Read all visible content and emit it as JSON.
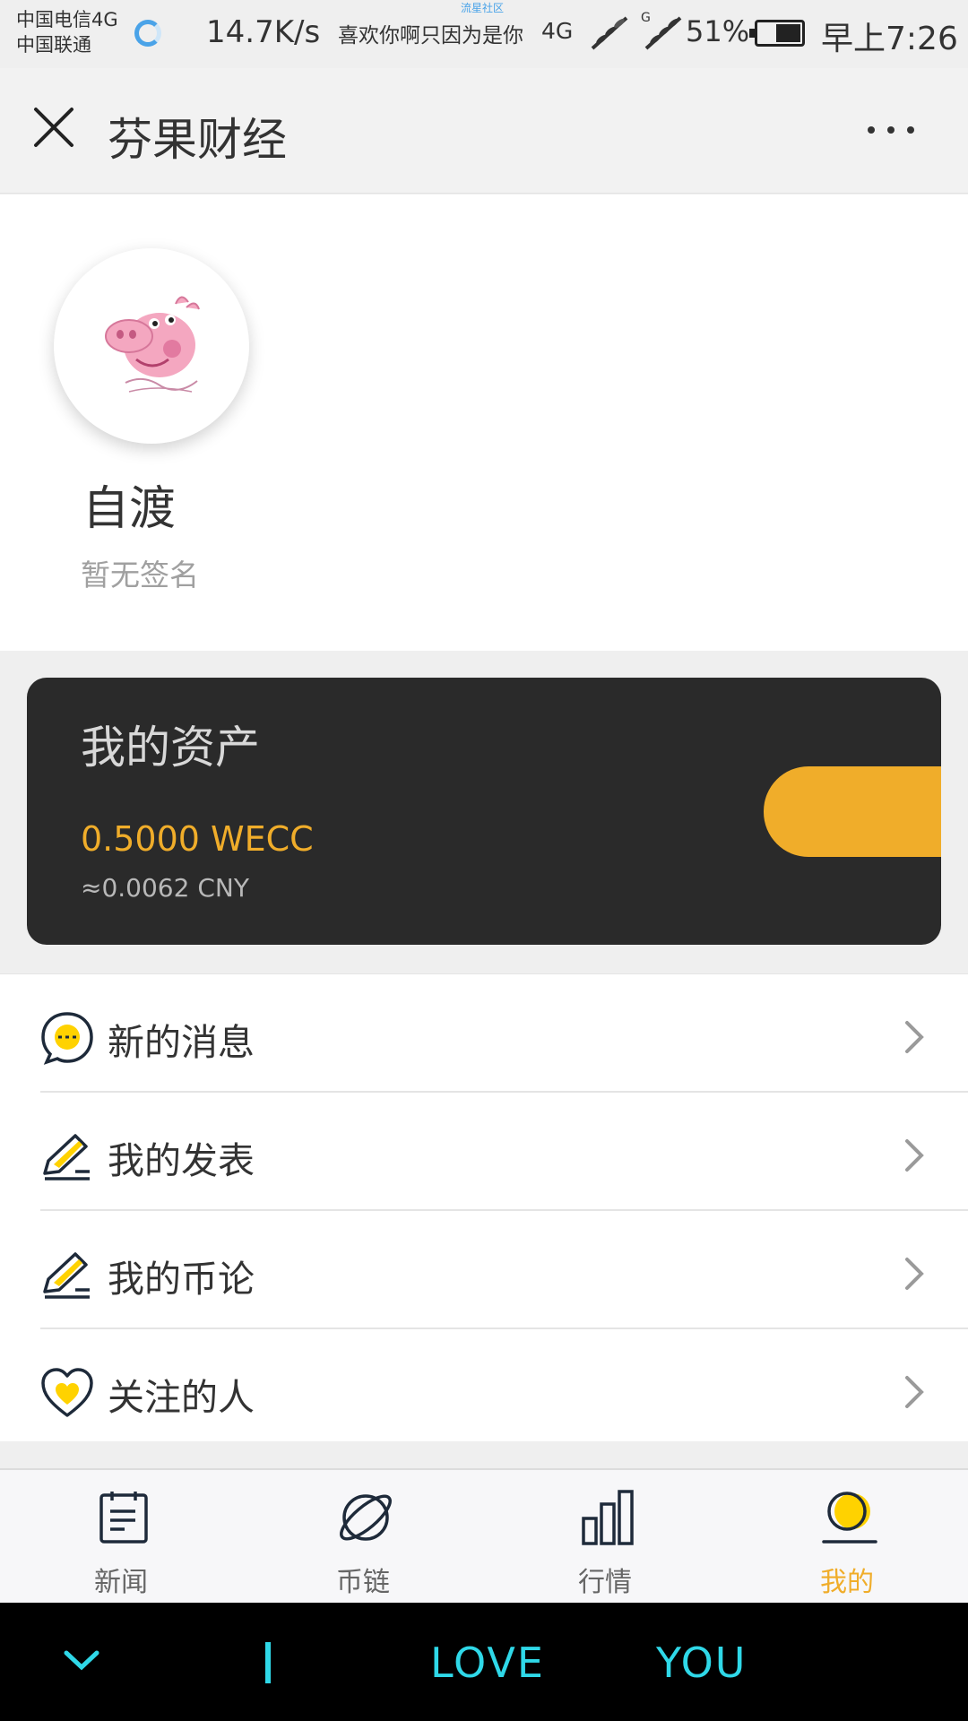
{
  "status_bar": {
    "carrier1": "中国电信4G",
    "carrier2": "中国联通",
    "speed": "14.7K/s",
    "now_playing": "喜欢你啊只因为是你",
    "community": "流星社区",
    "network": "4G",
    "battery": "51%",
    "time": "早上7:26"
  },
  "header": {
    "title": "芬果财经"
  },
  "profile": {
    "name": "自渡",
    "signature": "暂无签名"
  },
  "assets": {
    "title": "我的资产",
    "amount": "0.5000 WECC",
    "cny": "≈0.0062 CNY",
    "accent_color": "#f0ad2a"
  },
  "menu": [
    {
      "label": "新的消息",
      "icon": "message-icon"
    },
    {
      "label": "我的发表",
      "icon": "pen-icon"
    },
    {
      "label": "我的币论",
      "icon": "pen-icon"
    },
    {
      "label": "关注的人",
      "icon": "heart-icon"
    }
  ],
  "tabs": [
    {
      "label": "新闻",
      "icon": "news-icon"
    },
    {
      "label": "币链",
      "icon": "planet-icon"
    },
    {
      "label": "行情",
      "icon": "bar-chart-icon"
    },
    {
      "label": "我的",
      "icon": "profile-icon",
      "active": true
    }
  ],
  "lyric_bar": {
    "word1": "LOVE",
    "word2": "YOU"
  }
}
